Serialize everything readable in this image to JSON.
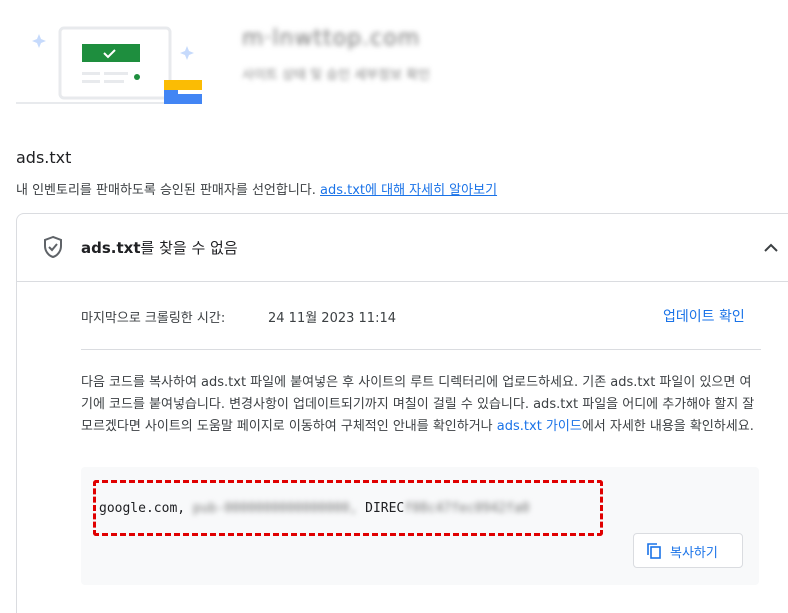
{
  "header": {
    "site_name": "m·lnwttop.com",
    "site_subtitle": "사이트 상태 및 승인 세부정보 확인"
  },
  "section": {
    "title": "ads.txt",
    "description": "내 인벤토리를 판매하도록 승인된 판매자를 선언합니다. ",
    "learn_more_link": "ads.txt에 대해 자세히 알아보기"
  },
  "card": {
    "title_bold": "ads.txt",
    "title_rest": "를 찾을 수 없음",
    "last_crawled_label": "마지막으로 크롤링한 시간:",
    "last_crawled_value": "24 11월 2023 11:14",
    "update_link": "업데이트 확인",
    "instructions_text": "다음 코드를 복사하여 ads.txt 파일에 붙여넣은 후 사이트의 루트 디렉터리에 업로드하세요. 기존 ads.txt 파일이 있으면 여기에 코드를 붙여넣습니다. 변경사항이 업데이트되기까지 며칠이 걸릴 수 있습니다. ads.txt 파일을 어디에 추가해야 할지 잘 모르겠다면 사이트의 도움말 페이지로 이동하여 구체적인 안내를 확인하거나 ",
    "guide_link": "ads.txt 가이드",
    "instructions_tail": "에서 자세한 내용을 확인하세요.",
    "code": {
      "domain": "google.com,",
      "publisher_id": "pub-0000000000000000,",
      "relationship": "DIREC",
      "cert_id": "f08c47fec0942fa0"
    },
    "copy_button": "복사하기"
  },
  "colors": {
    "link": "#1a73e8",
    "highlight_border": "#e00000",
    "illus_green": "#1e8e3e",
    "illus_yellow": "#fbbc04",
    "illus_blue": "#4285f4"
  }
}
